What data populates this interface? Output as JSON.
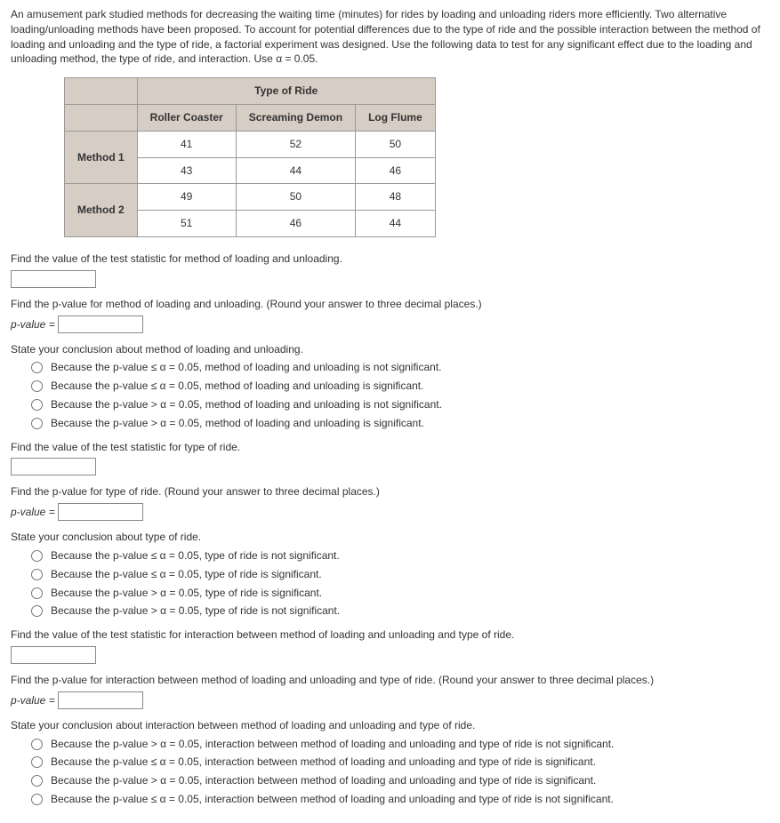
{
  "intro": "An amusement park studied methods for decreasing the waiting time (minutes) for rides by loading and unloading riders more efficiently. Two alternative loading/unloading methods have been proposed. To account for potential differences due to the type of ride and the possible interaction between the method of loading and unloading and the type of ride, a factorial experiment was designed. Use the following data to test for any significant effect due to the loading and unloading method, the type of ride, and interaction. Use α = 0.05.",
  "table": {
    "superheader": "Type of Ride",
    "cols": [
      "Roller Coaster",
      "Screaming Demon",
      "Log Flume"
    ],
    "rows": [
      {
        "label": "Method 1",
        "vals": [
          [
            "41",
            "52",
            "50"
          ],
          [
            "43",
            "44",
            "46"
          ]
        ]
      },
      {
        "label": "Method 2",
        "vals": [
          [
            "49",
            "50",
            "48"
          ],
          [
            "51",
            "46",
            "44"
          ]
        ]
      }
    ]
  },
  "q1": {
    "stat_prompt": "Find the value of the test statistic for method of loading and unloading.",
    "pval_prompt": "Find the p-value for method of loading and unloading. (Round your answer to three decimal places.)",
    "pval_label": "p-value =",
    "concl_prompt": "State your conclusion about method of loading and unloading.",
    "opts": [
      "Because the p-value ≤ α = 0.05, method of loading and unloading is not significant.",
      "Because the p-value ≤ α = 0.05, method of loading and unloading is significant.",
      "Because the p-value > α = 0.05, method of loading and unloading is not significant.",
      "Because the p-value > α = 0.05, method of loading and unloading is significant."
    ]
  },
  "q2": {
    "stat_prompt": "Find the value of the test statistic for type of ride.",
    "pval_prompt": "Find the p-value for type of ride. (Round your answer to three decimal places.)",
    "pval_label": "p-value =",
    "concl_prompt": "State your conclusion about type of ride.",
    "opts": [
      "Because the p-value ≤ α = 0.05, type of ride is not significant.",
      "Because the p-value ≤ α = 0.05, type of ride is significant.",
      "Because the p-value > α = 0.05, type of ride is significant.",
      "Because the p-value > α = 0.05, type of ride is not significant."
    ]
  },
  "q3": {
    "stat_prompt": "Find the value of the test statistic for interaction between method of loading and unloading and type of ride.",
    "pval_prompt": "Find the p-value for interaction between method of loading and unloading and type of ride. (Round your answer to three decimal places.)",
    "pval_label": "p-value =",
    "concl_prompt": "State your conclusion about interaction between method of loading and unloading and type of ride.",
    "opts": [
      "Because the p-value > α = 0.05, interaction between method of loading and unloading and type of ride is not significant.",
      "Because the p-value ≤ α = 0.05, interaction between method of loading and unloading and type of ride is significant.",
      "Because the p-value > α = 0.05, interaction between method of loading and unloading and type of ride is significant.",
      "Because the p-value ≤ α = 0.05, interaction between method of loading and unloading and type of ride is not significant."
    ]
  }
}
